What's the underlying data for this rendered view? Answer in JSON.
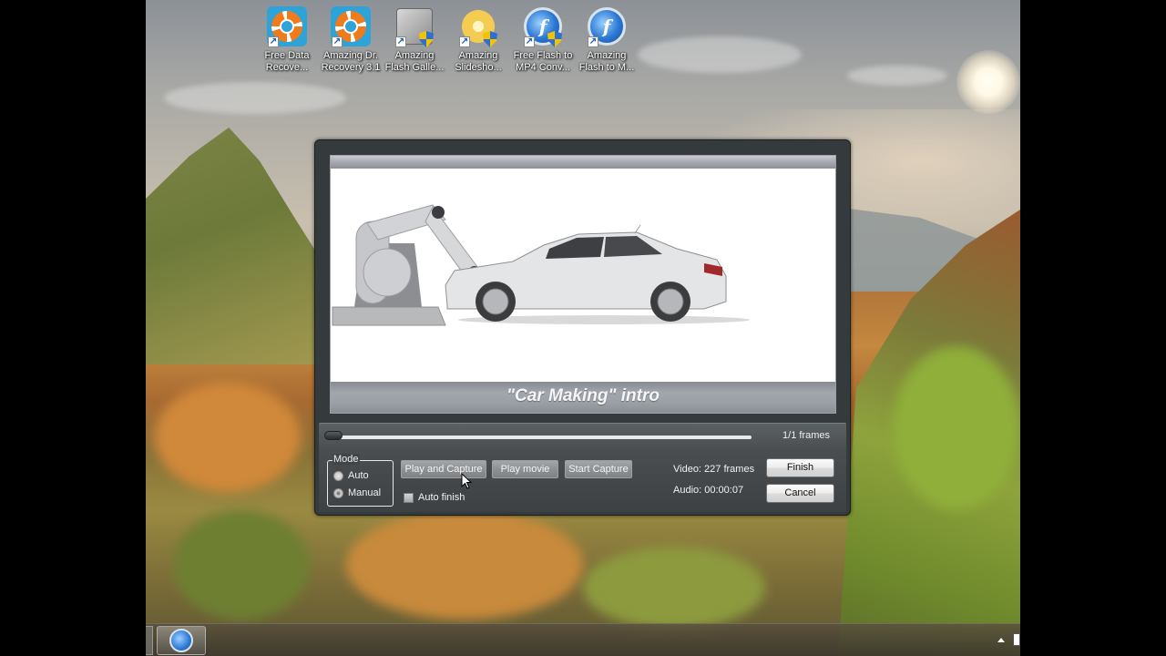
{
  "desktop": {
    "icons": [
      {
        "line1": "Free Data",
        "line2": "Recove...",
        "icon": "lifebuoy-icon"
      },
      {
        "line1": "Amazing Dr.",
        "line2": "Recovery 3.1",
        "icon": "lifebuoy-icon"
      },
      {
        "line1": "Amazing",
        "line2": "Flash Galle...",
        "icon": "flash-gallery-icon"
      },
      {
        "line1": "Amazing",
        "line2": "Slidesho...",
        "icon": "slideshow-flower-icon"
      },
      {
        "line1": "Free Flash to",
        "line2": "MP4 Conv...",
        "icon": "flash-converter-icon"
      },
      {
        "line1": "Amazing",
        "line2": "Flash to M...",
        "icon": "flash-converter-icon"
      }
    ]
  },
  "dialog": {
    "preview": {
      "caption": "\"Car Making\" intro"
    },
    "playback": {
      "position_fraction": 0.0,
      "frames_label": "1/1  frames"
    },
    "mode": {
      "legend": "Mode",
      "options": [
        {
          "label": "Auto",
          "checked": false
        },
        {
          "label": "Manual",
          "checked": true
        }
      ]
    },
    "buttons": {
      "play_and_capture": "Play and Capture",
      "play_movie": "Play movie",
      "start_capture": "Start Capture",
      "finish": "Finish",
      "cancel": "Cancel"
    },
    "auto_finish": {
      "label": "Auto finish",
      "checked": false
    },
    "info": {
      "video": "Video: 227 frames",
      "audio": "Audio: 00:00:07"
    }
  },
  "taskbar": {
    "pinned": [
      {
        "icon": "flash-converter-icon"
      }
    ],
    "tray": {
      "show_hidden_icon": "tray-up-arrow-icon",
      "action_center": "flag-icon"
    }
  }
}
